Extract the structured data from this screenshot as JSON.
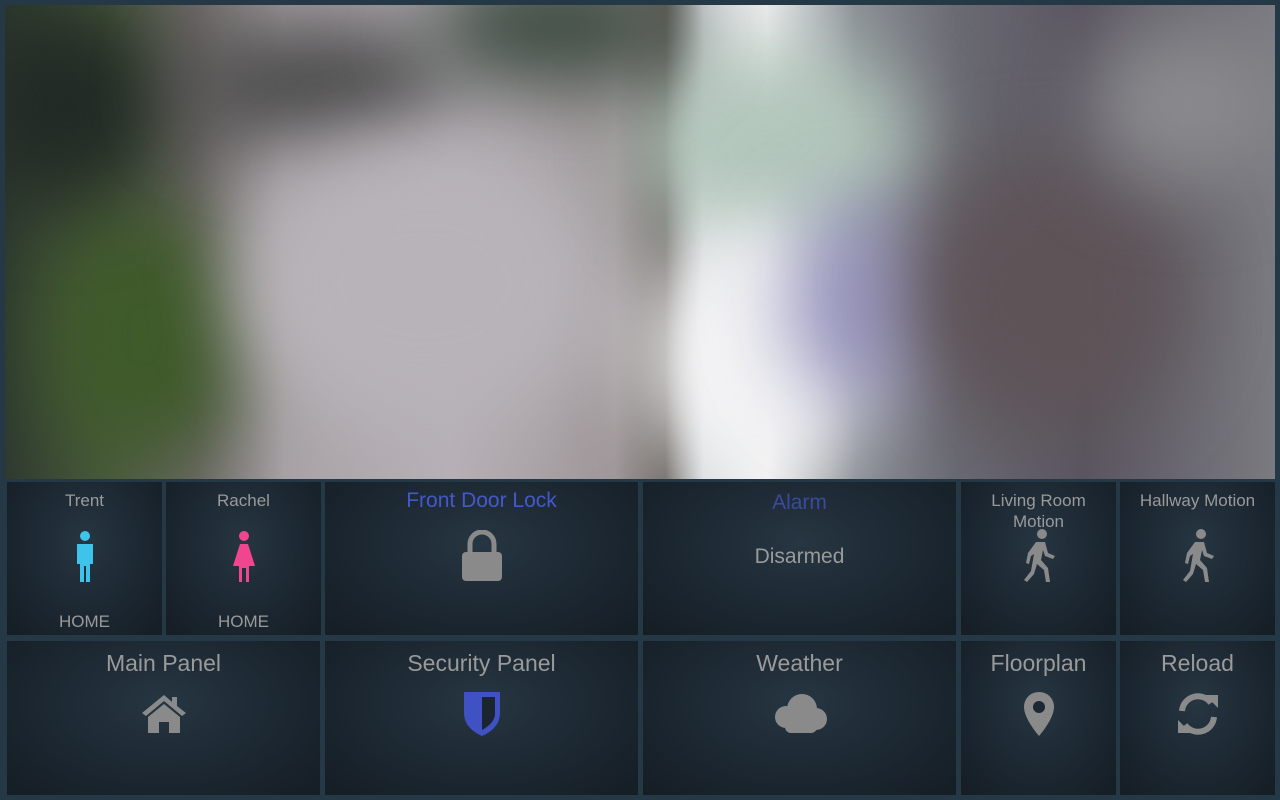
{
  "camera": {
    "name": "camera-feed"
  },
  "tiles": {
    "trent": {
      "title": "Trent",
      "state": "HOME",
      "icon": "male-person-icon",
      "color": "#3fc3ea"
    },
    "rachel": {
      "title": "Rachel",
      "state": "HOME",
      "icon": "female-person-icon",
      "color": "#f0468f"
    },
    "front_door": {
      "title": "Front Door Lock",
      "icon": "lock-icon",
      "title_color": "#4458cc"
    },
    "alarm": {
      "title": "Alarm",
      "state": "Disarmed",
      "title_color": "#3a4aa0"
    },
    "living_room": {
      "title_line1": "Living Room",
      "title_line2": "Motion",
      "icon": "walking-person-icon"
    },
    "hallway": {
      "title": "Hallway Motion",
      "icon": "walking-person-icon"
    },
    "main_panel": {
      "title": "Main Panel",
      "icon": "home-icon"
    },
    "security_panel": {
      "title": "Security Panel",
      "icon": "shield-icon",
      "icon_color": "#3f51c3"
    },
    "weather": {
      "title": "Weather",
      "icon": "cloud-icon"
    },
    "floorplan": {
      "title": "Floorplan",
      "icon": "map-marker-icon"
    },
    "reload": {
      "title": "Reload",
      "icon": "refresh-icon"
    }
  }
}
